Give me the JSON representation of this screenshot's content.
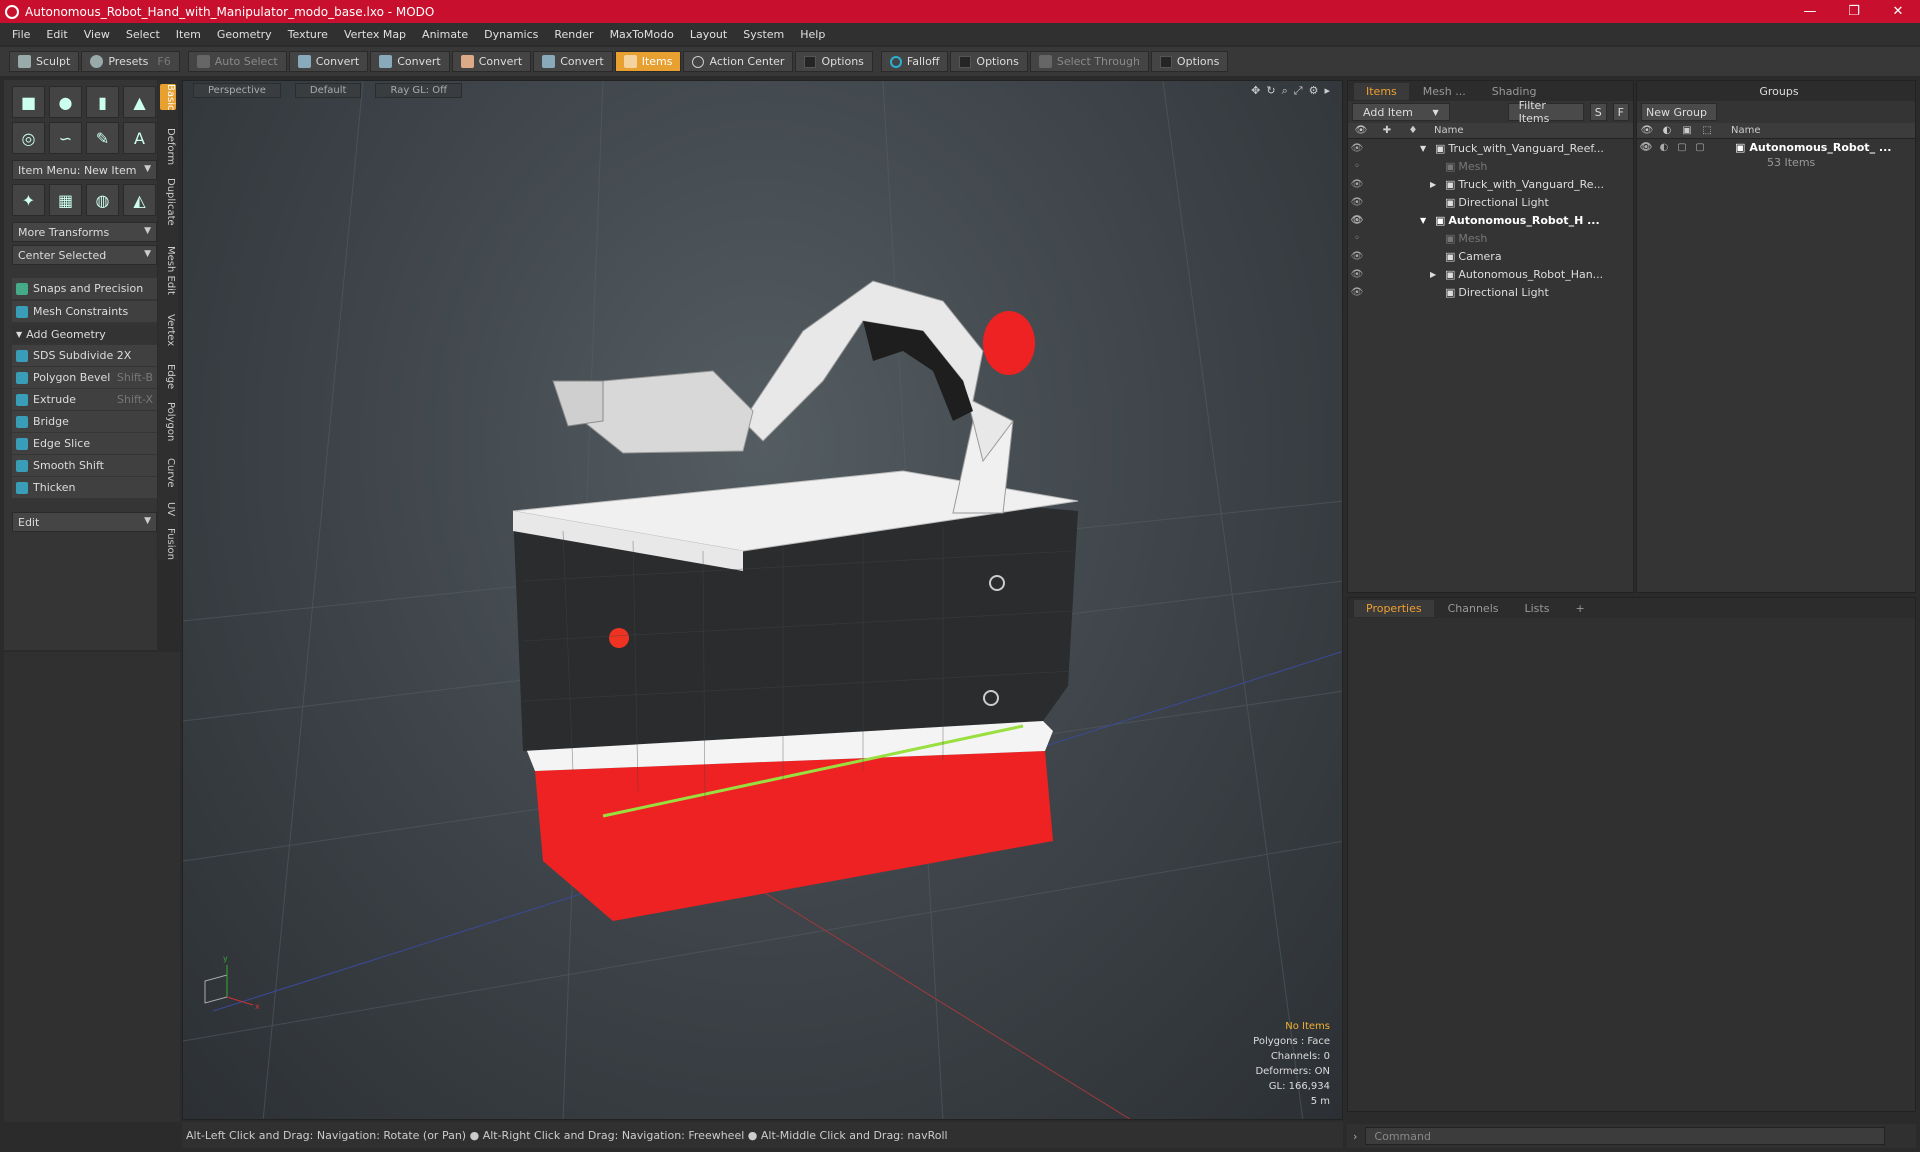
{
  "window": {
    "title": "Autonomous_Robot_Hand_with_Manipulator_modo_base.lxo - MODO",
    "min": "—",
    "max": "❐",
    "close": "✕"
  },
  "menu": [
    "File",
    "Edit",
    "View",
    "Select",
    "Item",
    "Geometry",
    "Texture",
    "Vertex Map",
    "Animate",
    "Dynamics",
    "Render",
    "MaxToModo",
    "Layout",
    "System",
    "Help"
  ],
  "toolbar": {
    "sculpt": "Sculpt",
    "presets": "Presets",
    "presets_key": "F6",
    "auto_select": "Auto Select",
    "convert1": "Convert",
    "convert2": "Convert",
    "convert3": "Convert",
    "convert4": "Convert",
    "items": "Items",
    "action_center": "Action Center",
    "options1": "Options",
    "falloff": "Falloff",
    "options2": "Options",
    "select_through": "Select Through",
    "options3": "Options"
  },
  "left": {
    "item_menu": "Item Menu: New Item",
    "more_transforms": "More Transforms",
    "center_selected": "Center Selected",
    "snaps": "Snaps and Precision",
    "mesh_constraints": "Mesh Constraints",
    "add_geometry": "Add Geometry",
    "tools": [
      {
        "label": "SDS Subdivide 2X",
        "key": ""
      },
      {
        "label": "Polygon Bevel",
        "key": "Shift-B"
      },
      {
        "label": "Extrude",
        "key": "Shift-X"
      },
      {
        "label": "Bridge",
        "key": ""
      },
      {
        "label": "Edge Slice",
        "key": ""
      },
      {
        "label": "Smooth Shift",
        "key": ""
      },
      {
        "label": "Thicken",
        "key": ""
      }
    ],
    "edit": "Edit"
  },
  "vtabs": [
    "Basic",
    "Deform",
    "Duplicate",
    "Mesh Edit",
    "Vertex",
    "Edge",
    "Polygon",
    "Curve",
    "UV",
    "Fusion"
  ],
  "viewport": {
    "perspective": "Perspective",
    "default": "Default",
    "raygl": "Ray GL: Off"
  },
  "hud": {
    "no_items": "No Items",
    "polygons": "Polygons : Face",
    "channels": "Channels: 0",
    "deformers": "Deformers: ON",
    "gl": "GL: 166,934",
    "scale": "5 m"
  },
  "status": "Alt-Left Click and Drag: Navigation: Rotate (or Pan) ● Alt-Right Click and Drag: Navigation: Freewheel ● Alt-Middle Click and Drag: navRoll",
  "items_panel": {
    "tabs": [
      "Items",
      "Mesh ...",
      "Shading"
    ],
    "add_item": "Add Item",
    "filter": "Filter Items",
    "s": "S",
    "f": "F",
    "name_col": "Name",
    "rows": [
      {
        "label": "Truck_with_Vanguard_Reef...",
        "indent": 0,
        "style": "normal",
        "arrow": "▼"
      },
      {
        "label": "Mesh",
        "indent": 1,
        "style": "dim",
        "arrow": ""
      },
      {
        "label": "Truck_with_Vanguard_Re...",
        "indent": 1,
        "style": "normal",
        "arrow": "▶"
      },
      {
        "label": "Directional Light",
        "indent": 1,
        "style": "normal",
        "arrow": ""
      },
      {
        "label": "Autonomous_Robot_H ...",
        "indent": 0,
        "style": "bold",
        "arrow": "▼"
      },
      {
        "label": "Mesh",
        "indent": 1,
        "style": "dim",
        "arrow": ""
      },
      {
        "label": "Camera",
        "indent": 1,
        "style": "normal",
        "arrow": ""
      },
      {
        "label": "Autonomous_Robot_Han...",
        "indent": 1,
        "style": "normal",
        "arrow": "▶"
      },
      {
        "label": "Directional Light",
        "indent": 1,
        "style": "normal",
        "arrow": ""
      }
    ]
  },
  "groups_panel": {
    "title": "Groups",
    "new_group": "New Group",
    "name_col": "Name",
    "group_name": "Autonomous_Robot_ ...",
    "group_count": "53 Items"
  },
  "props_panel": {
    "tabs": [
      "Properties",
      "Channels",
      "Lists"
    ],
    "add": "+"
  },
  "command": {
    "placeholder": "Command"
  },
  "colors": {
    "accent": "#e8a030",
    "title_red": "#c8102e",
    "robot_red": "#ee2222"
  }
}
